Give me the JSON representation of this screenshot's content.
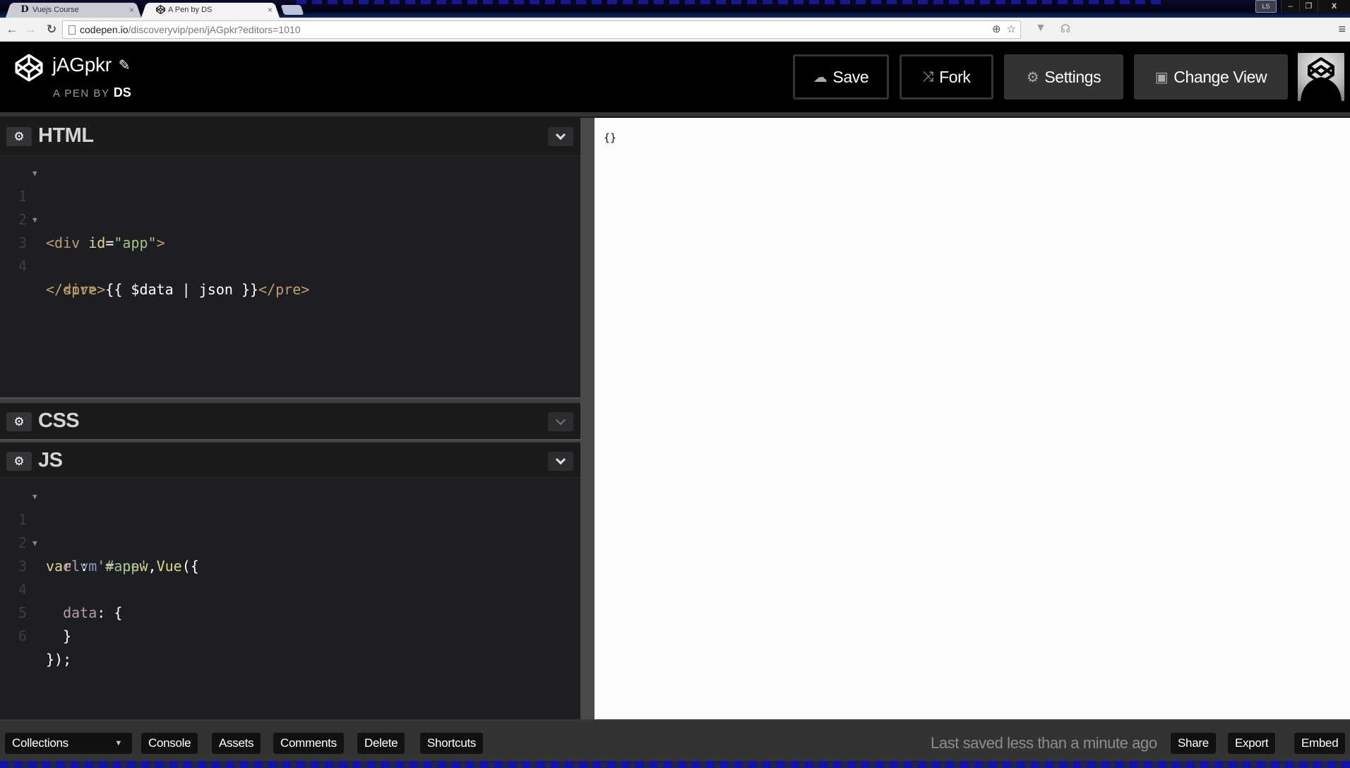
{
  "browser": {
    "tabs": [
      {
        "title": "Vuejs Course",
        "favicon": "D-logo-icon",
        "active": false
      },
      {
        "title": "A Pen by DS",
        "favicon": "codepen-icon",
        "active": true
      }
    ],
    "close_glyph": "×",
    "user_badge": "LS",
    "window_controls": {
      "minimize": "–",
      "restore": "❐",
      "close": "X"
    },
    "url_host": "codepen.io",
    "url_path": "/discoveryvip/pen/jAGpkr?editors=1010"
  },
  "header": {
    "pen_title": "jAGpkr",
    "pen_by_label": "A PEN BY",
    "author": "DS",
    "buttons": {
      "save": "Save",
      "fork": "Fork",
      "settings": "Settings",
      "change_view": "Change View"
    }
  },
  "editors": {
    "html": {
      "title": "HTML",
      "lines": [
        {
          "n": "1",
          "fold": true
        },
        {
          "n": "2",
          "fold": false
        },
        {
          "n": "3",
          "fold": true
        },
        {
          "n": "4",
          "fold": false
        }
      ],
      "tokens": {
        "l1_open": "<div ",
        "l1_attr": "id",
        "l1_eq": "=",
        "l1_val": "\"app\"",
        "l1_close": ">",
        "l3_open": "  <pre>",
        "l3_expr": "{{ $data | json }}",
        "l3_close": "</pre>",
        "l4": "</div>"
      }
    },
    "css": {
      "title": "CSS"
    },
    "js": {
      "title": "JS",
      "lines": [
        {
          "n": "1",
          "fold": true
        },
        {
          "n": "2",
          "fold": false
        },
        {
          "n": "3",
          "fold": true
        },
        {
          "n": "4",
          "fold": false
        },
        {
          "n": "5",
          "fold": false
        },
        {
          "n": "6",
          "fold": false
        }
      ],
      "tokens": {
        "l1_var": "var ",
        "l1_name": "vm",
        "l1_eq": " = ",
        "l1_new": "new ",
        "l1_vue": "Vue",
        "l1_punc": "({",
        "l2_prop": "  el",
        "l2_colon": ": ",
        "l2_str": "'#app'",
        "l2_comma": ",",
        "l3_prop": "  data",
        "l3_rest": ": {",
        "l5": "  }",
        "l6": "});"
      }
    }
  },
  "preview": {
    "output": "{}"
  },
  "footer": {
    "collections": "Collections",
    "console": "Console",
    "assets": "Assets",
    "comments": "Comments",
    "delete": "Delete",
    "shortcuts": "Shortcuts",
    "status": "Last saved less than a minute ago",
    "share": "Share",
    "export": "Export",
    "embed": "Embed"
  }
}
